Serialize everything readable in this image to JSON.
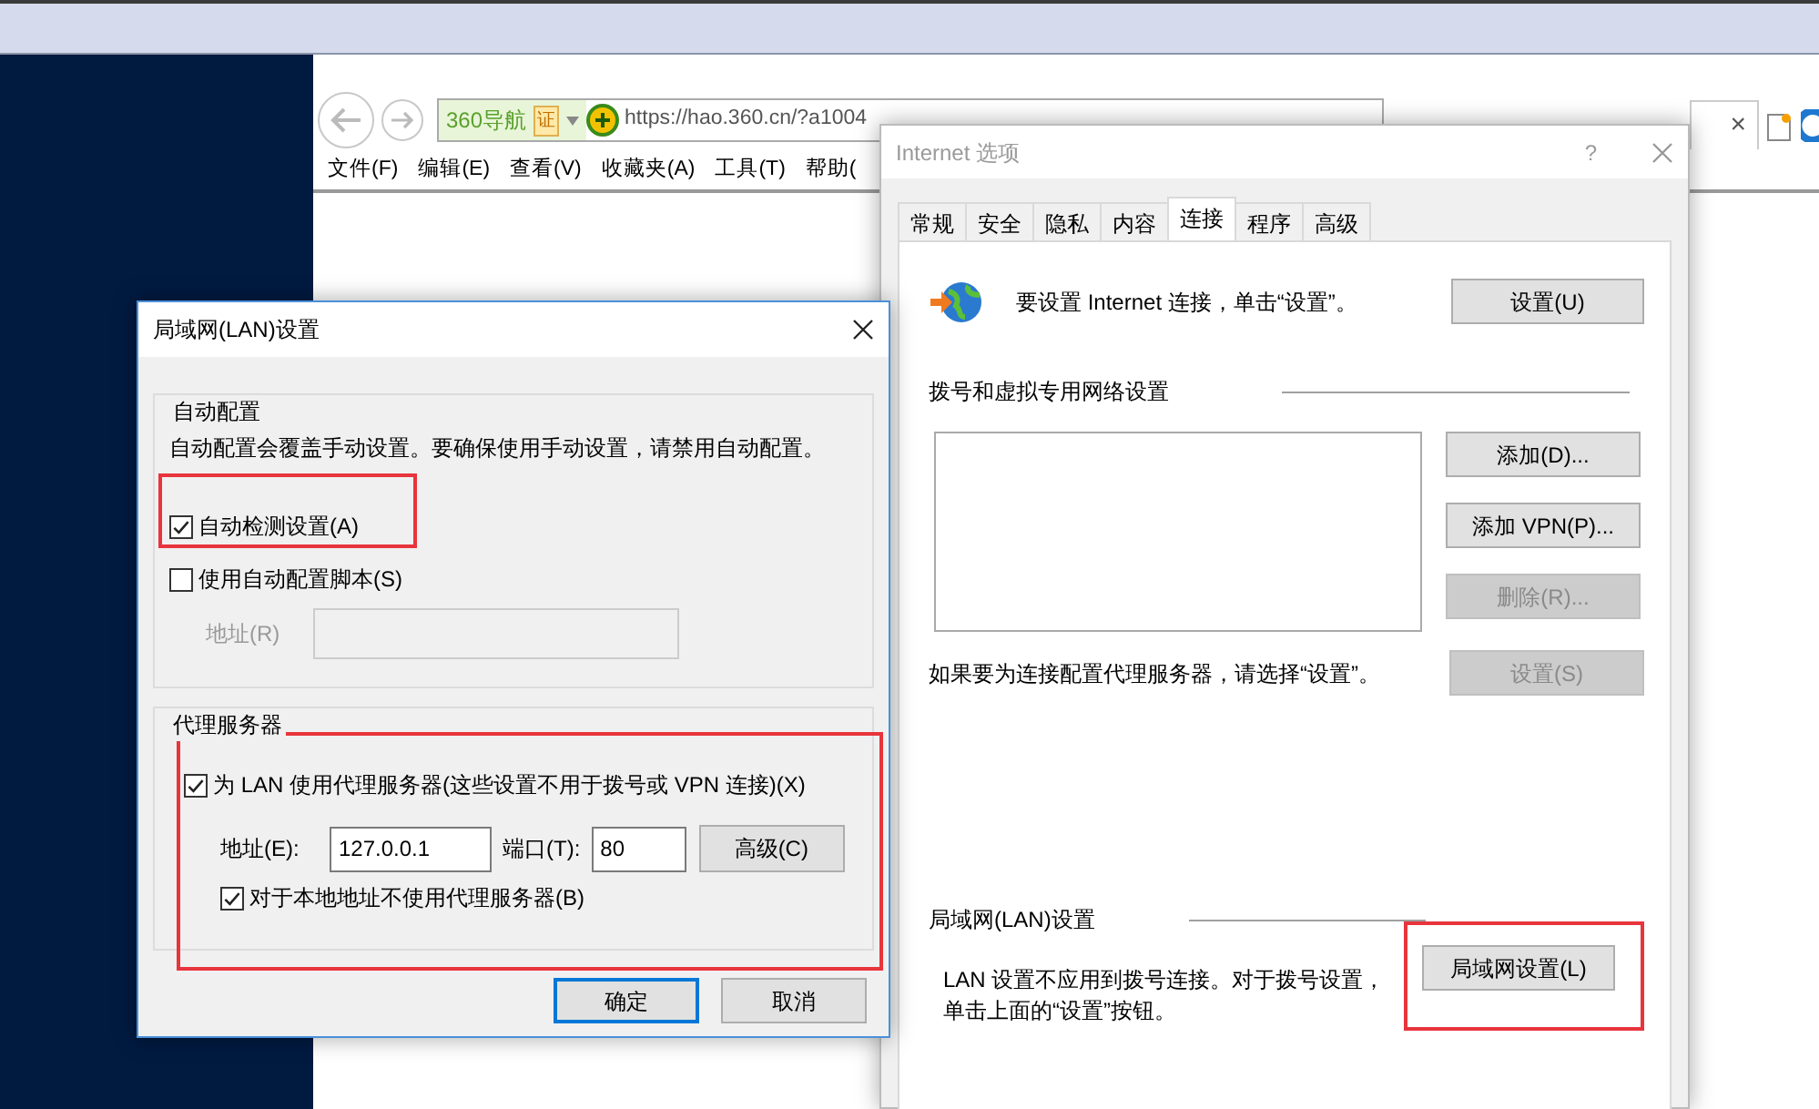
{
  "browser": {
    "site_label": "360导航",
    "cert_badge": "证",
    "url": "https://hao.360.cn/?a1004",
    "tab_close": "×",
    "menu": [
      "文件(F)",
      "编辑(E)",
      "查看(V)",
      "收藏夹(A)",
      "工具(T)",
      "帮助("
    ]
  },
  "lan_dialog": {
    "title": "局域网(LAN)设置",
    "auto_config": {
      "legend": "自动配置",
      "description": "自动配置会覆盖手动设置。要确保使用手动设置，请禁用自动配置。",
      "options": [
        {
          "label": "自动检测设置(A)",
          "checked": true,
          "highlighted": true
        },
        {
          "label": "使用自动配置脚本(S)",
          "checked": false,
          "highlighted": false
        }
      ],
      "script_address": {
        "label": "地址(R)",
        "disabled": true
      }
    },
    "proxy": {
      "legend": "代理服务器",
      "highlighted": true,
      "use_proxy": {
        "label": "为 LAN 使用代理服务器(这些设置不用于拨号或 VPN 连接)(X)",
        "checked": true
      },
      "address": {
        "label": "地址(E):",
        "value": "127.0.0.1"
      },
      "port": {
        "label": "端口(T):",
        "value": "80"
      },
      "advanced_button": "高级(C)",
      "bypass_local": {
        "label": "对于本地地址不使用代理服务器(B)",
        "checked": true
      }
    },
    "buttons": [
      {
        "label": "确定",
        "default": true
      },
      {
        "label": "取消",
        "default": false
      }
    ]
  },
  "options_dialog": {
    "title": "Internet 选项",
    "help": "?",
    "tabs": [
      {
        "label": "常规",
        "selected": false
      },
      {
        "label": "安全",
        "selected": false
      },
      {
        "label": "隐私",
        "selected": false
      },
      {
        "label": "内容",
        "selected": false
      },
      {
        "label": "连接",
        "selected": true
      },
      {
        "label": "程序",
        "selected": false
      },
      {
        "label": "高级",
        "selected": false
      }
    ],
    "setup_text": "要设置 Internet 连接，单击“设置”。",
    "setup_button": "设置(U)",
    "dialup": {
      "heading": "拨号和虚拟专用网络设置",
      "buttons": [
        {
          "label": "添加(D)...",
          "disabled": false
        },
        {
          "label": "添加 VPN(P)...",
          "disabled": false
        },
        {
          "label": "删除(R)...",
          "disabled": true
        }
      ],
      "proxy_hint": "如果要为连接配置代理服务器，请选择“设置”。",
      "settings_button": {
        "label": "设置(S)",
        "disabled": true
      }
    },
    "lan": {
      "heading": "局域网(LAN)设置",
      "description": "LAN 设置不应用到拨号连接。对于拨号设置，单击上面的“设置”按钮。",
      "button": "局域网设置(L)",
      "highlighted": true
    }
  }
}
